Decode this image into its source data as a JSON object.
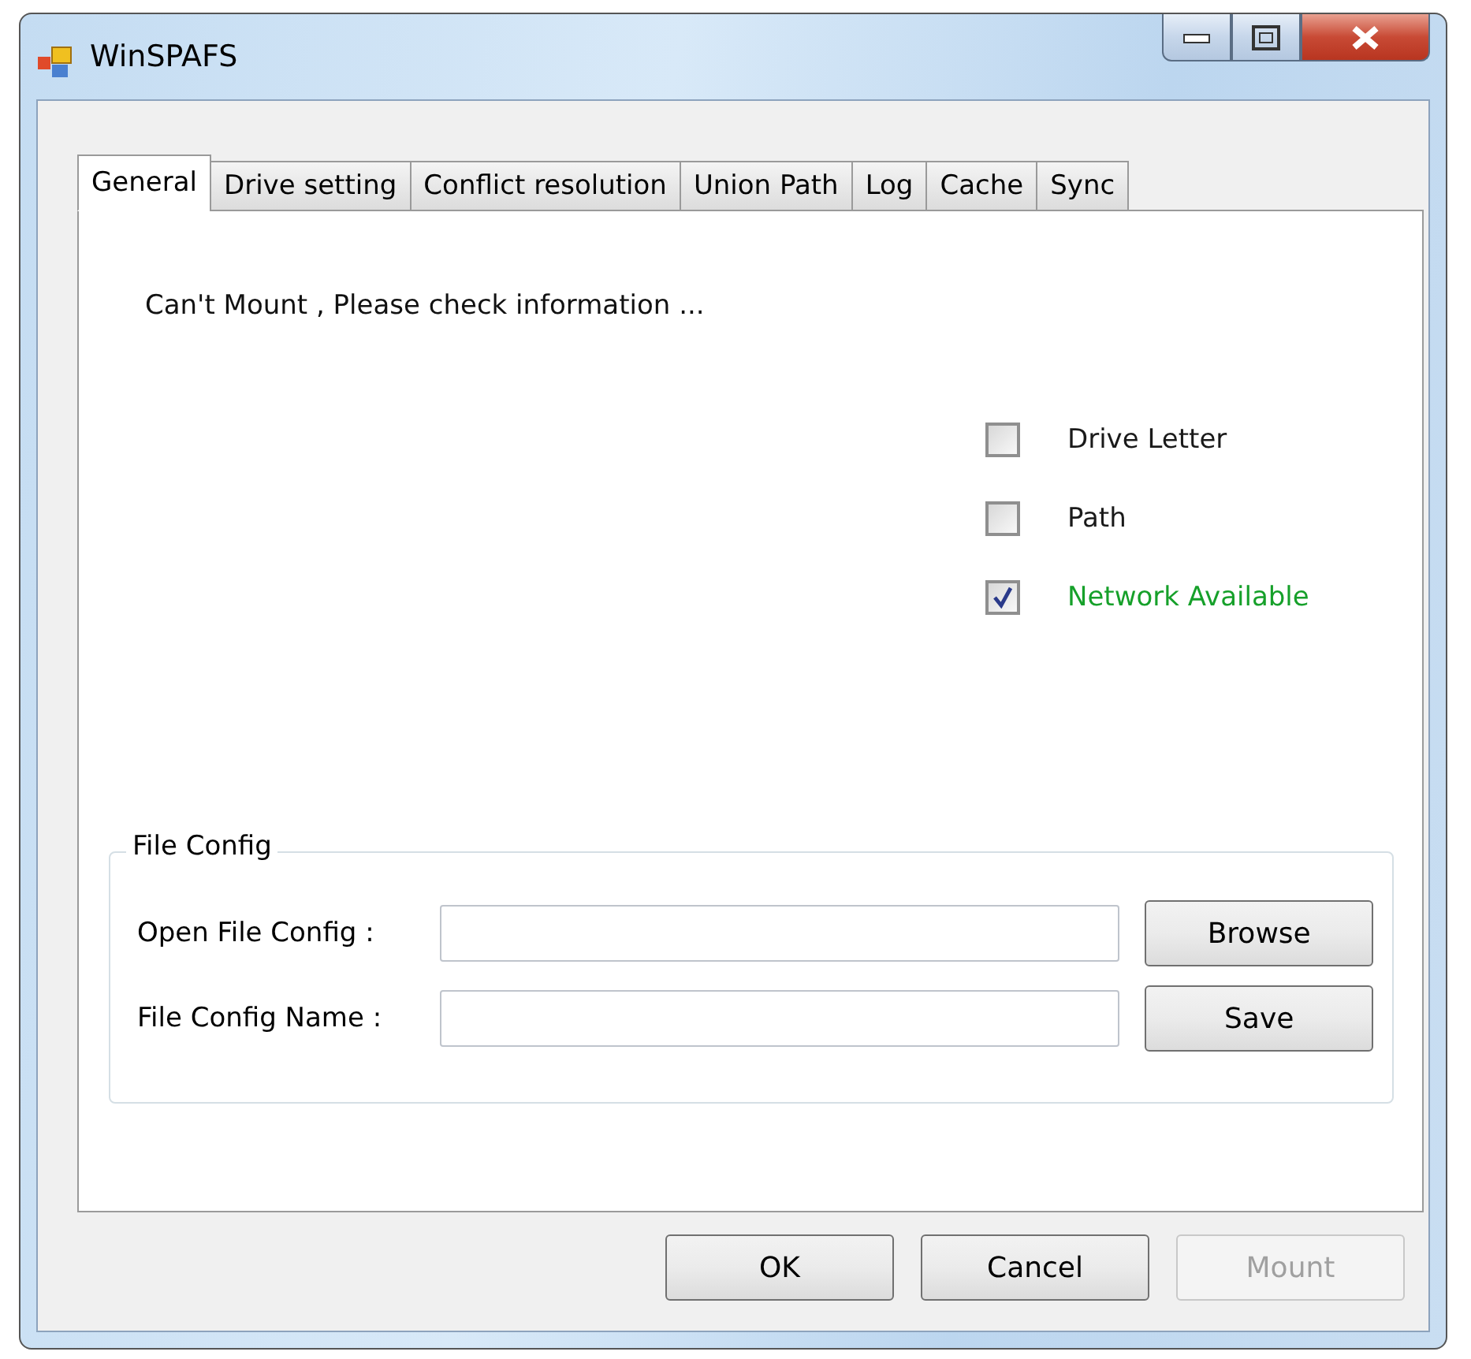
{
  "window": {
    "title": "WinSPAFS"
  },
  "tabs": [
    {
      "label": "General",
      "selected": true
    },
    {
      "label": "Drive setting",
      "selected": false
    },
    {
      "label": "Conflict resolution",
      "selected": false
    },
    {
      "label": "Union Path",
      "selected": false
    },
    {
      "label": "Log",
      "selected": false
    },
    {
      "label": "Cache",
      "selected": false
    },
    {
      "label": "Sync",
      "selected": false
    }
  ],
  "message": "Can't Mount , Please check information ...",
  "checks": [
    {
      "label": "Drive Letter",
      "checked": false,
      "color": "#1a1a1a"
    },
    {
      "label": "Path",
      "checked": false,
      "color": "#1a1a1a"
    },
    {
      "label": "Network Available",
      "checked": true,
      "color": "#16a02a"
    }
  ],
  "file_config": {
    "title": "File Config",
    "rows": [
      {
        "label": "Open File Config :",
        "button": "Browse"
      },
      {
        "label": "File Config Name :",
        "button": "Save"
      }
    ]
  },
  "buttons": [
    {
      "label": "OK",
      "disabled": false
    },
    {
      "label": "Cancel",
      "disabled": false
    },
    {
      "label": "Mount",
      "disabled": true
    }
  ]
}
